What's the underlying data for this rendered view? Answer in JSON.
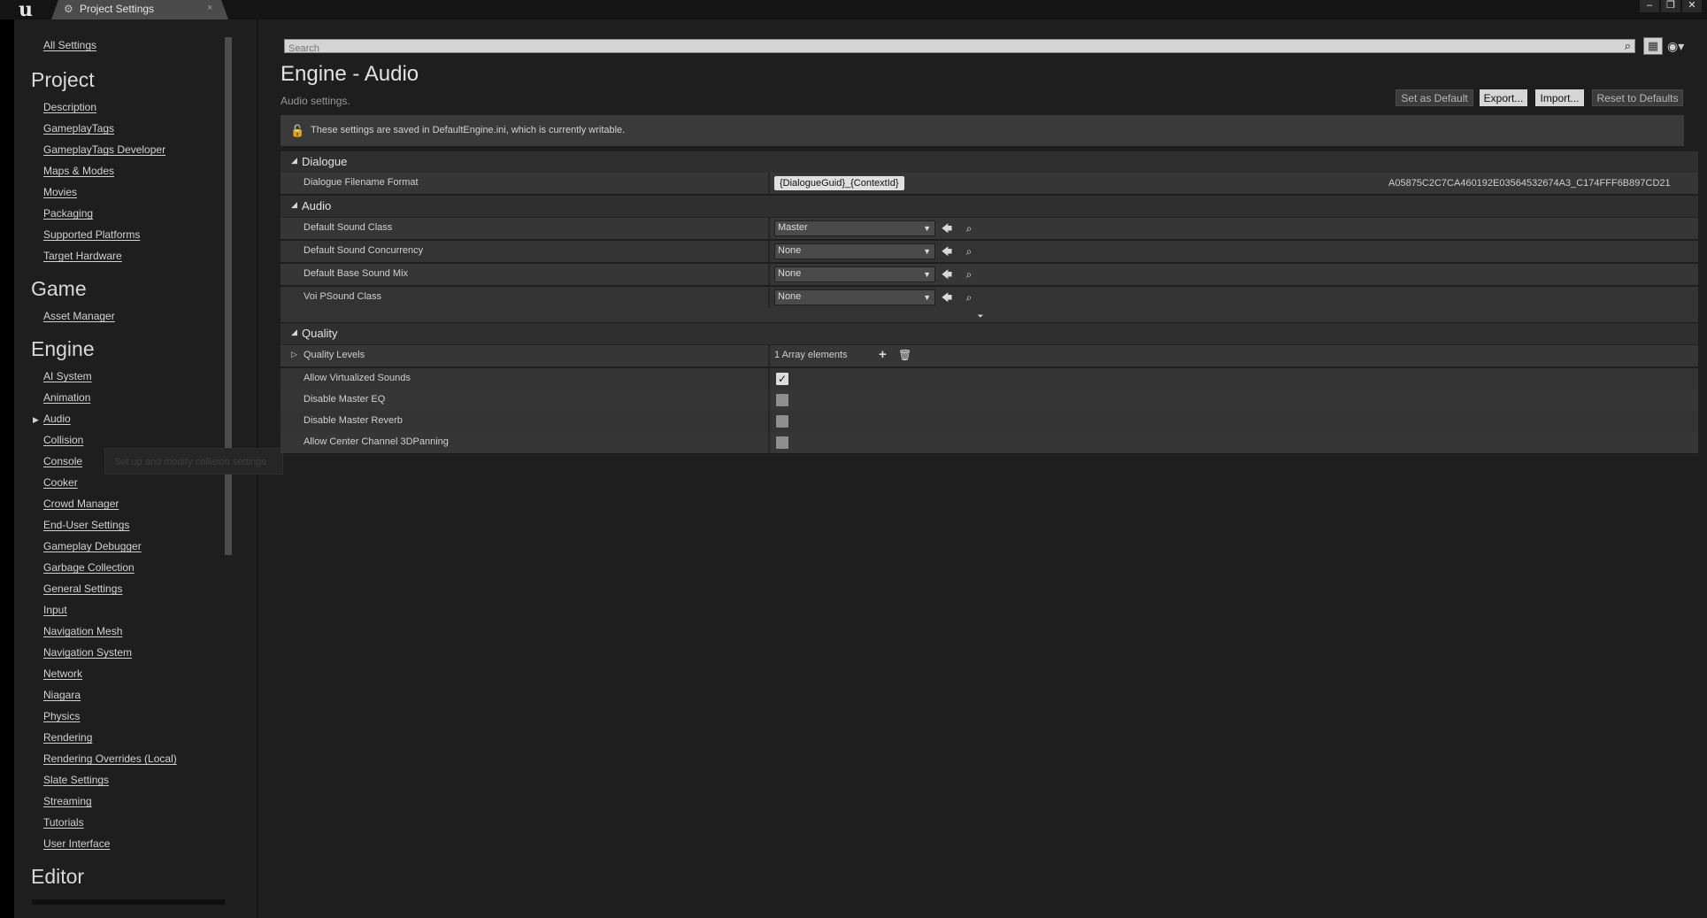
{
  "window": {
    "tab_label": "Project Settings",
    "tab_close": "×",
    "logo": "u",
    "minimize": "–",
    "maximize": "❐",
    "close": "✕"
  },
  "sidebar": {
    "all_settings": "All Settings",
    "tooltip": "Set up and modify collision settings",
    "sections": {
      "project": {
        "title": "Project",
        "items": [
          "Description",
          "GameplayTags",
          "GameplayTags Developer",
          "Maps & Modes",
          "Movies",
          "Packaging",
          "Supported Platforms",
          "Target Hardware"
        ]
      },
      "game": {
        "title": "Game",
        "items": [
          "Asset Manager"
        ]
      },
      "engine": {
        "title": "Engine",
        "items": [
          "AI System",
          "Animation",
          "Audio",
          "Collision",
          "Console",
          "Cooker",
          "Crowd Manager",
          "End-User Settings",
          "Gameplay Debugger",
          "Garbage Collection",
          "General Settings",
          "Input",
          "Navigation Mesh",
          "Navigation System",
          "Network",
          "Niagara",
          "Physics",
          "Rendering",
          "Rendering Overrides (Local)",
          "Slate Settings",
          "Streaming",
          "Tutorials",
          "User Interface"
        ]
      },
      "editor": {
        "title": "Editor"
      }
    }
  },
  "search": {
    "placeholder": "Search"
  },
  "page": {
    "title": "Engine - Audio",
    "subtitle": "Audio settings.",
    "buttons": {
      "set_default": "Set as Default",
      "export": "Export...",
      "import": "Import...",
      "reset": "Reset to Defaults"
    },
    "notice": "These settings are saved in DefaultEngine.ini, which is currently writable."
  },
  "categories": {
    "dialogue": {
      "title": "Dialogue",
      "filename_format_label": "Dialogue Filename Format",
      "filename_format_value": "{DialogueGuid}_{ContextId}",
      "filename_format_preview": "A05875C2C7CA460192E03564532674A3_C174FFF6B897CD21"
    },
    "audio": {
      "title": "Audio",
      "rows": [
        {
          "label": "Default Sound Class",
          "value": "Master"
        },
        {
          "label": "Default Sound Concurrency",
          "value": "None"
        },
        {
          "label": "Default Base Sound Mix",
          "value": "None"
        },
        {
          "label": "Voi PSound Class",
          "value": "None"
        }
      ]
    },
    "quality": {
      "title": "Quality",
      "quality_levels_label": "Quality Levels",
      "quality_levels_value": "1 Array elements",
      "rows": [
        {
          "label": "Allow Virtualized Sounds",
          "checked": true
        },
        {
          "label": "Disable Master EQ",
          "checked": false
        },
        {
          "label": "Disable Master Reverb",
          "checked": false
        },
        {
          "label": "Allow Center Channel 3DPanning",
          "checked": false
        }
      ]
    }
  },
  "icons": {
    "settings": "⚙",
    "search": "⌕",
    "grid": "▦",
    "eye": "◉▾",
    "lock": "🔓",
    "collapse": "◢",
    "expand": "▷",
    "dropdown": "▼",
    "reset_arrow": "🡄",
    "browse": "⌕",
    "add": "+",
    "delete": "🗑",
    "advanced": "⏷",
    "check": "✓",
    "selected_arrow": "▶"
  }
}
